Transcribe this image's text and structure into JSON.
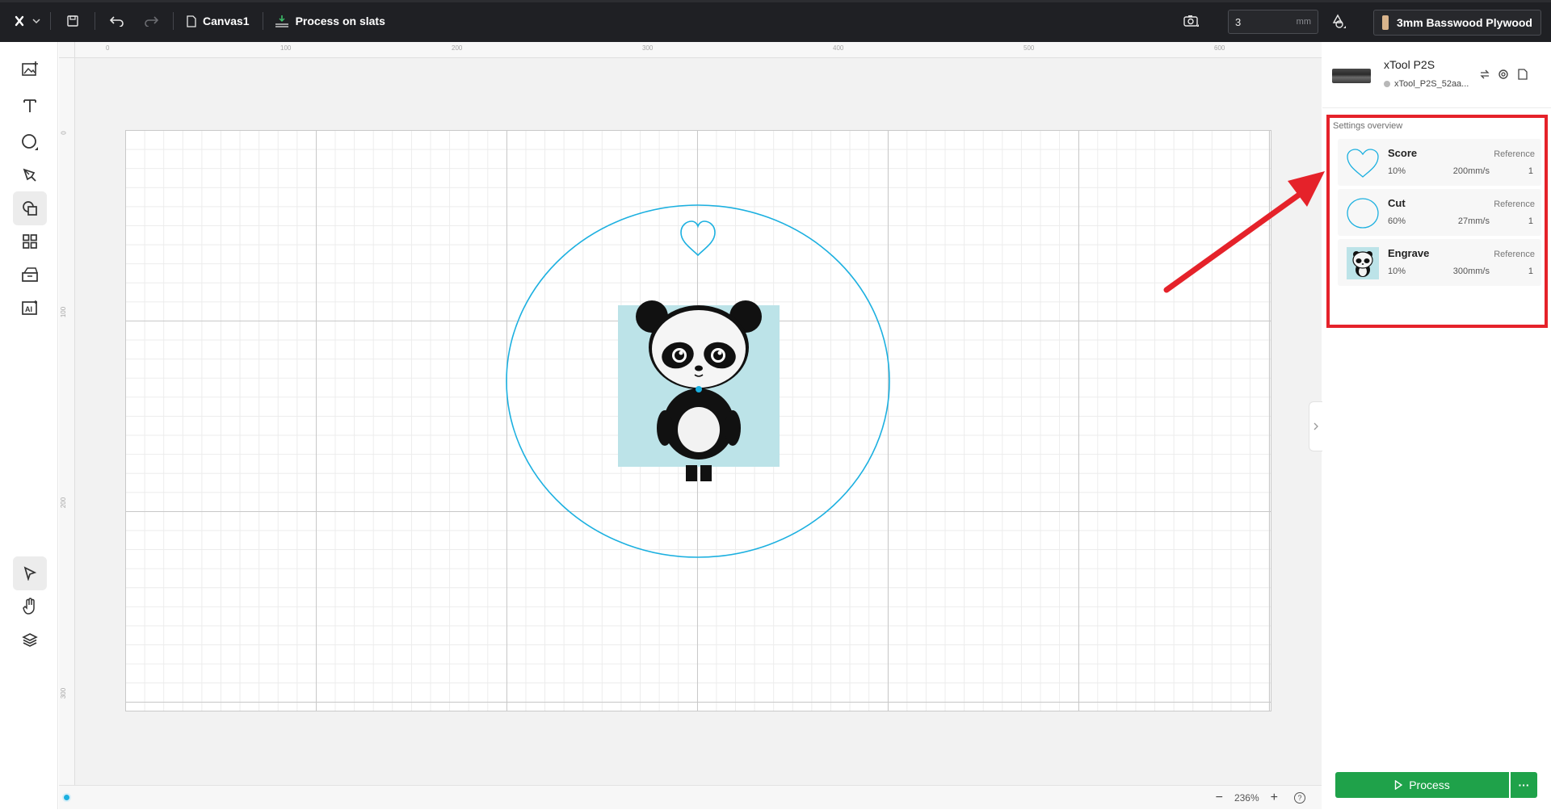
{
  "topbar": {
    "canvas_name": "Canvas1",
    "process_mode": "Process on slats",
    "thickness_value": "3",
    "thickness_unit": "mm",
    "material_name": "3mm Basswood Plywood",
    "material_color": "#d8b48c"
  },
  "left_tools": [
    {
      "name": "image-icon",
      "active": false
    },
    {
      "name": "text-icon",
      "active": false
    },
    {
      "name": "shape-icon",
      "active": false
    },
    {
      "name": "pen-icon",
      "active": false
    },
    {
      "name": "shapes-library-icon",
      "active": true
    },
    {
      "name": "components-icon",
      "active": false
    },
    {
      "name": "materials-icon",
      "active": false
    },
    {
      "name": "ai-icon",
      "active": false
    },
    {
      "name": "select-icon",
      "active": false
    },
    {
      "name": "hand-icon",
      "active": false
    },
    {
      "name": "layers-icon",
      "active": false
    }
  ],
  "rulers": {
    "top": [
      "0",
      "100",
      "200",
      "300",
      "400",
      "500",
      "600"
    ],
    "left": [
      "0",
      "100",
      "200",
      "300"
    ]
  },
  "zoom": {
    "level": "236%"
  },
  "canvas_colors": {
    "vector_stroke": "#1cb0e0",
    "image_bg": "#bce3e8"
  },
  "device": {
    "name": "xTool P2S",
    "serial": "xTool_P2S_52aa..."
  },
  "overview": {
    "title": "Settings overview",
    "items": [
      {
        "mode": "Score",
        "reference": "Reference",
        "power": "10%",
        "speed": "200mm/s",
        "passes": "1",
        "thumb": "heart-thumb"
      },
      {
        "mode": "Cut",
        "reference": "Reference",
        "power": "60%",
        "speed": "27mm/s",
        "passes": "1",
        "thumb": "circle-thumb"
      },
      {
        "mode": "Engrave",
        "reference": "Reference",
        "power": "10%",
        "speed": "300mm/s",
        "passes": "1",
        "thumb": "panda-thumb"
      }
    ]
  },
  "process_button": {
    "label": "Process",
    "more": "···"
  },
  "accent_colors": {
    "process": "#1fa24a",
    "highlight": "#e5222a",
    "annotation_arrow": "#e5222a"
  }
}
